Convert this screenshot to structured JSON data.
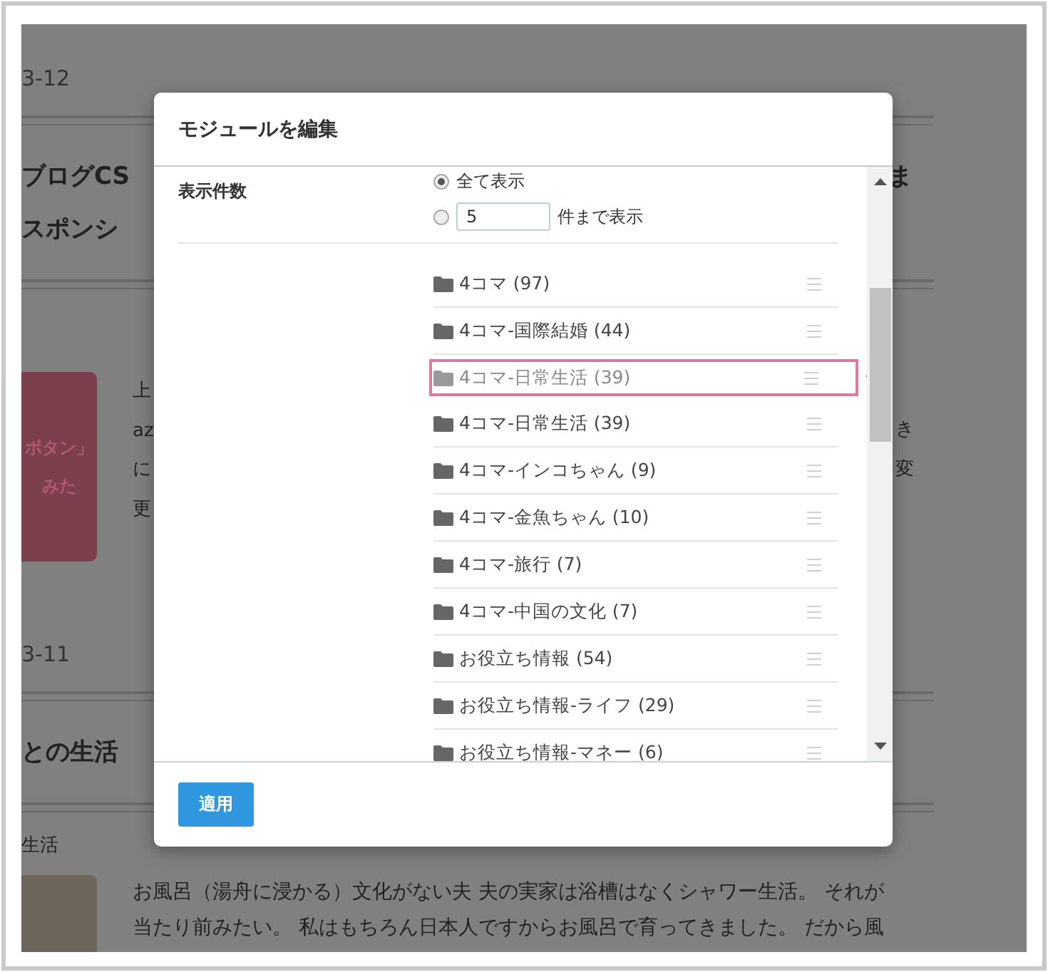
{
  "background_page": {
    "date_1": "3-12",
    "title_line_1": "ブログCS",
    "title_line_1_right": "ま",
    "title_line_2": "スポンシ",
    "card_text": [
      "ボタン」",
      "みた"
    ],
    "excerpt_left": [
      "上",
      "az",
      "に",
      "更"
    ],
    "excerpt_right": [
      "き",
      "変"
    ],
    "date_2": "3-11",
    "title_2": "との生活",
    "category_2": "生活",
    "excerpt_2": [
      "お風呂（湯舟に浸かる）文化がない夫 夫の実家は浴槽はなくシャワー生活。 それが",
      "当たり前みたい。 私はもちろん日本人ですからお風呂で育ってきました。 だから風"
    ]
  },
  "dialog": {
    "title": "モジュールを編集",
    "display_count": {
      "label": "表示件数",
      "options": [
        {
          "kind": "all",
          "label": "全て表示",
          "selected": true
        },
        {
          "kind": "limit",
          "value": "5",
          "unit_label": "件まで表示",
          "selected": false
        }
      ]
    },
    "categories": [
      {
        "kind": "item",
        "label": "4コマ (97)"
      },
      {
        "kind": "item",
        "label": "4コマ-国際結婚 (44)"
      },
      {
        "kind": "dragging",
        "label": "4コマ-日常生活 (39)"
      },
      {
        "kind": "item",
        "label": "4コマ-日常生活 (39)"
      },
      {
        "kind": "item",
        "label": "4コマ-インコちゃん (9)"
      },
      {
        "kind": "item",
        "label": "4コマ-金魚ちゃん (10)"
      },
      {
        "kind": "item",
        "label": "4コマ-旅行 (7)"
      },
      {
        "kind": "item",
        "label": "4コマ-中国の文化 (7)"
      },
      {
        "kind": "item",
        "label": "お役立ち情報 (54)"
      },
      {
        "kind": "item",
        "label": "お役立ち情報-ライフ (29)"
      },
      {
        "kind": "item",
        "label": "お役立ち情報-マネー (6)"
      }
    ],
    "apply_button": "適用"
  }
}
